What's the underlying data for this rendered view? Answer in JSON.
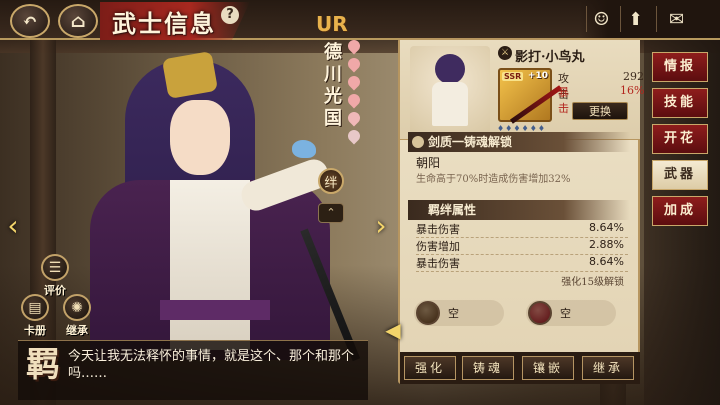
{
  "header": {
    "title": "武士信息",
    "help": "?",
    "back_icon": "back-arrow-icon",
    "home_icon": "castle-icon",
    "right_icons": [
      "character-icon",
      "up-arrow-icon",
      "mail-icon"
    ]
  },
  "character": {
    "rarity": "UR",
    "name": "德川光国",
    "bond_badge": "绊",
    "quote": "今天让我无法释怀的事情，就是这个、那个和那个吗……",
    "quote_mark": "羁",
    "petal_colors": [
      "#f0a8a8",
      "#f0a8a8",
      "#f0a8a8",
      "#f0a8a8",
      "#f0b8b8",
      "#e8c8c8"
    ]
  },
  "left_buttons": [
    {
      "label": "评价",
      "icon": "review-icon"
    },
    {
      "label": "卡册",
      "icon": "card-album-icon"
    },
    {
      "label": "继承",
      "icon": "inherit-icon"
    }
  ],
  "weapon": {
    "name": "影打·小鸟丸",
    "rarity_badge": "SSR",
    "level": "+10",
    "stats": [
      {
        "label": "攻击",
        "value": "292"
      },
      {
        "label": "暴击",
        "value": "16%"
      }
    ],
    "swap_label": "更换",
    "soul_section": "剑质一铸魂解锁",
    "soul_title": "朝阳",
    "soul_desc": "生命高于70%时造成伤害增加32%",
    "bond_section": "羁绊属性",
    "bond_attrs": [
      {
        "label": "暴击伤害",
        "value": "8.64%"
      },
      {
        "label": "伤害增加",
        "value": "2.88%"
      },
      {
        "label": "暴击伤害",
        "value": "8.64%"
      }
    ],
    "unlock_note": "强化15级解锁",
    "slots": [
      {
        "label": "空",
        "color": "#3a2410"
      },
      {
        "label": "空",
        "color": "#5a0e12"
      }
    ],
    "actions": [
      "强化",
      "铸魂",
      "镶嵌",
      "继承"
    ]
  },
  "tabs": [
    {
      "label": "情报",
      "active": false
    },
    {
      "label": "技能",
      "active": false
    },
    {
      "label": "开花",
      "active": false
    },
    {
      "label": "武器",
      "active": true
    },
    {
      "label": "加成",
      "active": false
    }
  ]
}
